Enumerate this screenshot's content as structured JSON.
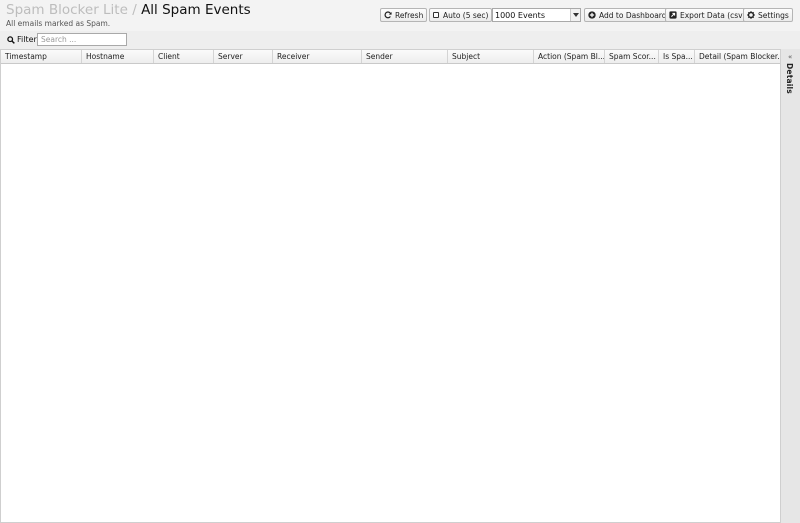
{
  "header": {
    "app_name": "Spam Blocker Lite",
    "separator": "/",
    "page_title": "All Spam Events",
    "subtitle": "All emails marked as Spam."
  },
  "toolbar": {
    "refresh_label": "Refresh",
    "auto_label": "Auto (5 sec)",
    "auto_checked": false,
    "events_selected": "1000 Events",
    "add_dashboard_label": "Add to Dashboard",
    "export_label": "Export Data (csv)",
    "settings_label": "Settings"
  },
  "filter": {
    "label": "Filter",
    "placeholder": "Search ...",
    "value": ""
  },
  "table": {
    "columns": [
      "Timestamp",
      "Hostname",
      "Client",
      "Server",
      "Receiver",
      "Sender",
      "Subject",
      "Action (Spam Bl...",
      "Spam Scor...",
      "Is Spa...",
      "Detail (Spam Blocker..."
    ],
    "rows": []
  },
  "details_panel": {
    "label": "Details",
    "collapse_glyph": "«"
  }
}
